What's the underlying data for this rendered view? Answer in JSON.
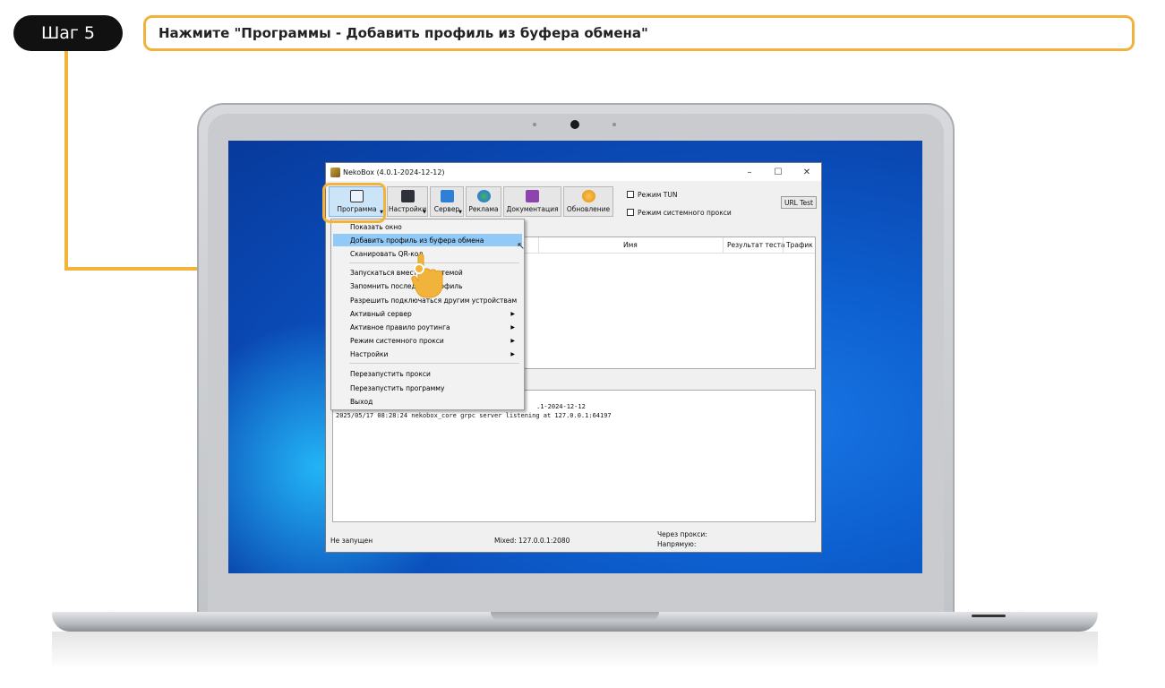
{
  "step": {
    "badge": "Шаг 5",
    "instruction": "Нажмите \"Программы  - Добавить профиль из буфера обмена\""
  },
  "colors": {
    "accent": "#f2b33d",
    "badge_bg": "#111111",
    "menu_highlight": "#91c9f7",
    "desktop": "#0a48b3"
  },
  "window": {
    "title": "NekoBox (4.0.1-2024-12-12)",
    "controls": [
      "–",
      "☐",
      "✕"
    ],
    "toolbar": [
      {
        "label": "Программа",
        "icon": "program-icon"
      },
      {
        "label": "Настройки",
        "icon": "settings-icon"
      },
      {
        "label": "Сервер",
        "icon": "server-icon"
      },
      {
        "label": "Реклама",
        "icon": "globe-icon"
      },
      {
        "label": "Документация",
        "icon": "doc-icon"
      },
      {
        "label": "Обновление",
        "icon": "update-icon"
      }
    ],
    "checkboxes": [
      "Режим TUN",
      "Режим системного прокси"
    ],
    "url_test": "URL Test",
    "table_headers": {
      "name": "Имя",
      "test_result": "Результат теста",
      "traffic": "Трафик"
    },
    "log_lines": [
      ".1-2024-12-12",
      "2025/05/17 08:28:24 nekobox_core grpc server listening at 127.0.0.1:64197"
    ],
    "status": {
      "state": "Не запущен",
      "mixed": "Mixed: 127.0.0.1:2080",
      "via_proxy": "Через прокси:",
      "direct": "Напрямую:"
    }
  },
  "menu": {
    "items": [
      {
        "label": "Показать окно"
      },
      {
        "label": "Добавить профиль из буфера обмена"
      },
      {
        "label": "Сканировать QR-код"
      },
      {
        "label": "Запускаться вместе с системой"
      },
      {
        "label": "Запомнить последний профиль"
      },
      {
        "label": "Разрешить подключаться другим устройствам"
      },
      {
        "label": "Активный сервер",
        "submenu": "▶"
      },
      {
        "label": "Активное правило роутинга",
        "submenu": "▶"
      },
      {
        "label": "Режим системного прокси",
        "submenu": "▶"
      },
      {
        "label": "Настройки",
        "submenu": "▶"
      },
      {
        "label": "Перезапустить прокси"
      },
      {
        "label": "Перезапустить программу"
      },
      {
        "label": "Выход"
      }
    ]
  }
}
